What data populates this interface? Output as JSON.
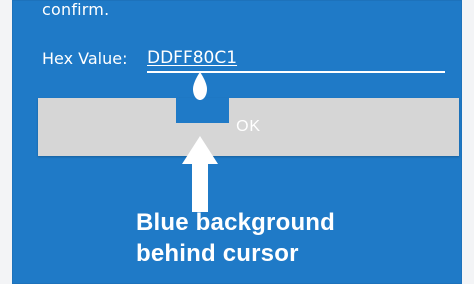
{
  "dialog": {
    "confirm_text": "confirm.",
    "hex_label": "Hex Value:",
    "hex_value": "DDFF80C1",
    "ok_label": "OK"
  },
  "annotation": {
    "line1": "Blue background",
    "line2": "behind cursor"
  },
  "colors": {
    "dialog_background": "#1f7ac7",
    "button_background": "#d6d6d6",
    "text": "#ffffff",
    "frame": "#f3f4f6"
  },
  "icons": {
    "cursor_handle": "text-selection-handle-icon",
    "pointer_arrow": "up-arrow-icon"
  }
}
